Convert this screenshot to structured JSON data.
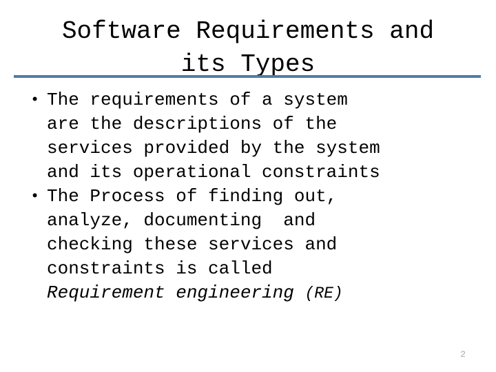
{
  "slide": {
    "title_lines": [
      "Software Requirements and",
      "its Types"
    ],
    "divider_color": "#4f7ca4",
    "bullets": [
      {
        "marker": "•",
        "lines": [
          "The requirements of a system",
          "are the descriptions of the",
          "services provided by the system",
          "and its operational constraints"
        ]
      },
      {
        "marker": "•",
        "lines": [
          "The Process of finding out,",
          "analyze, documenting  and",
          "checking these services and",
          "constraints is called"
        ],
        "italic_line": "Requirement engineering ",
        "italic_tail": "(RE)"
      }
    ],
    "page_number": "2"
  }
}
